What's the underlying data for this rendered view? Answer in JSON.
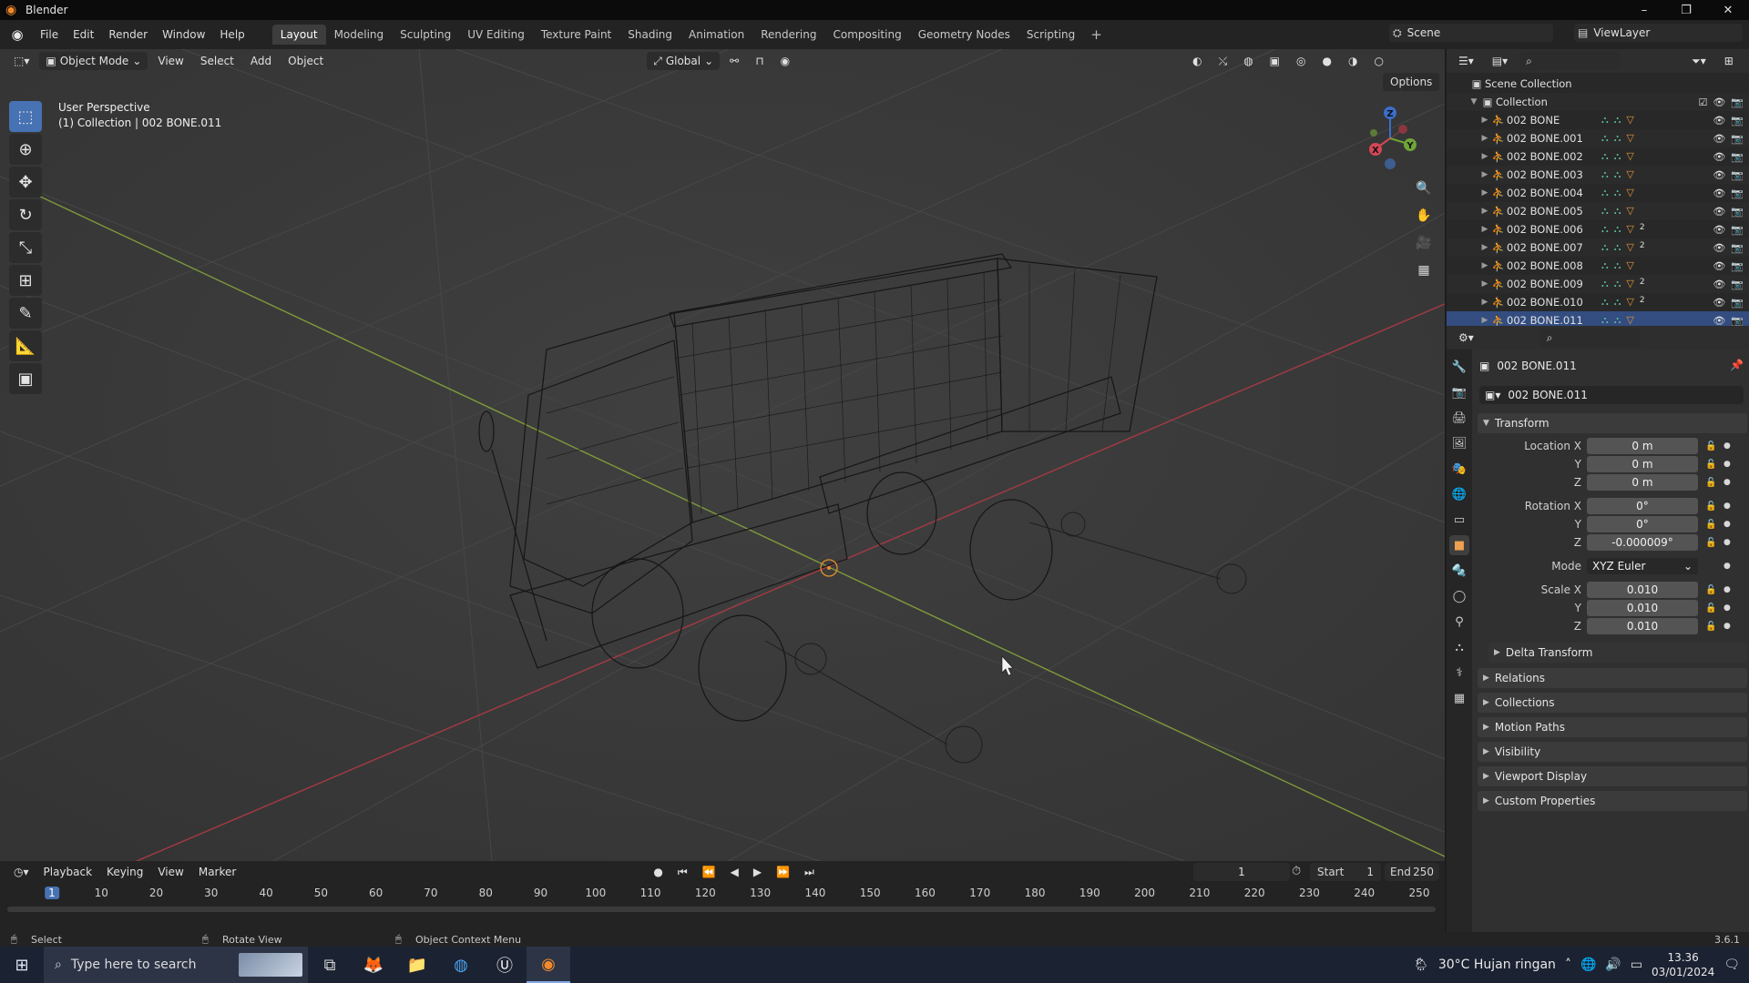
{
  "window": {
    "title": "Blender",
    "controls": [
      "–",
      "❐",
      "✕"
    ]
  },
  "menubar": {
    "menus": [
      "File",
      "Edit",
      "Render",
      "Window",
      "Help"
    ],
    "workspaces": [
      "Layout",
      "Modeling",
      "Sculpting",
      "UV Editing",
      "Texture Paint",
      "Shading",
      "Animation",
      "Rendering",
      "Compositing",
      "Geometry Nodes",
      "Scripting"
    ],
    "active_workspace": "Layout",
    "add_label": "+",
    "scene": "Scene",
    "view_layer": "ViewLayer"
  },
  "viewport": {
    "mode": "Object Mode",
    "menus": [
      "View",
      "Select",
      "Add",
      "Object"
    ],
    "orientation": "Global",
    "options_label": "Options",
    "info_line1": "User Perspective",
    "info_line2": "(1) Collection | 002 BONE.011",
    "gizmo_axes": [
      "X",
      "Y",
      "Z"
    ]
  },
  "outliner": {
    "root": "Scene Collection",
    "collection": "Collection",
    "items": [
      {
        "name": "002 BONE",
        "sub": ""
      },
      {
        "name": "002 BONE.001",
        "sub": ""
      },
      {
        "name": "002 BONE.002",
        "sub": ""
      },
      {
        "name": "002 BONE.003",
        "sub": ""
      },
      {
        "name": "002 BONE.004",
        "sub": ""
      },
      {
        "name": "002 BONE.005",
        "sub": ""
      },
      {
        "name": "002 BONE.006",
        "sub": "2"
      },
      {
        "name": "002 BONE.007",
        "sub": "2"
      },
      {
        "name": "002 BONE.008",
        "sub": ""
      },
      {
        "name": "002 BONE.009",
        "sub": "2"
      },
      {
        "name": "002 BONE.010",
        "sub": "2"
      },
      {
        "name": "002 BONE.011",
        "sub": ""
      }
    ]
  },
  "properties": {
    "object_name": "002 BONE.011",
    "data_name": "002 BONE.011",
    "transform_label": "Transform",
    "location": {
      "label": "Location X",
      "x": "0 m",
      "y": "0 m",
      "z": "0 m"
    },
    "rotation": {
      "label": "Rotation X",
      "x": "0°",
      "y": "0°",
      "z": "-0.000009°"
    },
    "mode_label": "Mode",
    "mode_value": "XYZ Euler",
    "scale": {
      "label": "Scale X",
      "x": "0.010",
      "y": "0.010",
      "z": "0.010"
    },
    "axis_y": "Y",
    "axis_z": "Z",
    "panels": [
      "Delta Transform",
      "Relations",
      "Collections",
      "Motion Paths",
      "Visibility",
      "Viewport Display",
      "Custom Properties"
    ]
  },
  "timeline": {
    "menus": [
      "Playback",
      "Keying",
      "View",
      "Marker"
    ],
    "current_frame": "1",
    "start_label": "Start",
    "start": "1",
    "end_label": "End",
    "end": "250",
    "ticks": [
      "1",
      "10",
      "20",
      "30",
      "40",
      "50",
      "60",
      "70",
      "80",
      "90",
      "100",
      "110",
      "120",
      "130",
      "140",
      "150",
      "160",
      "170",
      "180",
      "190",
      "200",
      "210",
      "220",
      "230",
      "240",
      "250"
    ]
  },
  "statusbar": {
    "select": "Select",
    "rotate": "Rotate View",
    "context": "Object Context Menu",
    "version": "3.6.1"
  },
  "taskbar": {
    "search_placeholder": "Type here to search",
    "weather": "30°C  Hujan ringan",
    "time": "13.36",
    "date": "03/01/2024"
  }
}
